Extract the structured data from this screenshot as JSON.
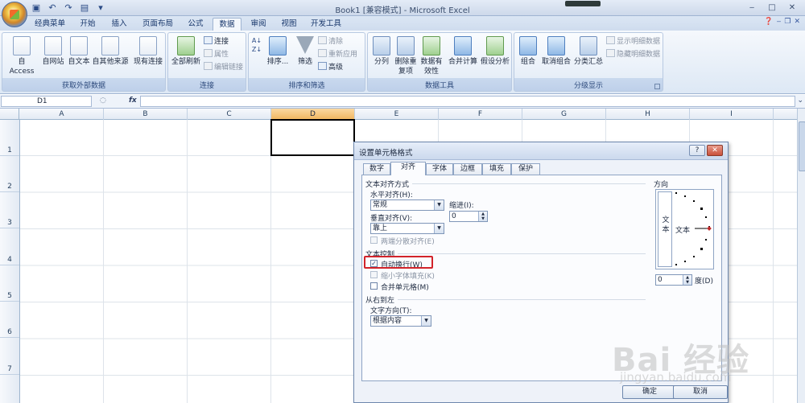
{
  "window": {
    "title": "Book1  [兼容模式] - Microsoft Excel",
    "controls": [
      "‒",
      "□",
      "✕"
    ]
  },
  "ribbon_tabs": [
    "经典菜单",
    "开始",
    "插入",
    "页面布局",
    "公式",
    "数据",
    "审阅",
    "视图",
    "开发工具"
  ],
  "active_tab": "数据",
  "groups": {
    "external": {
      "label": "获取外部数据",
      "buttons": [
        "自 Access",
        "自网站",
        "自文本",
        "自其他来源",
        "现有连接"
      ]
    },
    "connections": {
      "label": "连接",
      "refresh_all": "全部刷新",
      "items": [
        "连接",
        "属性",
        "编辑链接"
      ]
    },
    "sort_filter": {
      "label": "排序和筛选",
      "sort": "排序...",
      "filter": "筛选",
      "items": [
        "清除",
        "重新应用",
        "高级"
      ]
    },
    "data_tools": {
      "label": "数据工具",
      "buttons": [
        "分列",
        "删除重复项",
        "数据有效性",
        "合并计算",
        "假设分析"
      ]
    },
    "outline": {
      "label": "分级显示",
      "buttons": [
        "组合",
        "取消组合",
        "分类汇总"
      ],
      "items": [
        "显示明细数据",
        "隐藏明细数据"
      ]
    }
  },
  "formula_bar": {
    "name_box": "D1",
    "fx": "fx",
    "value": ""
  },
  "columns": [
    "A",
    "B",
    "C",
    "D",
    "E",
    "F",
    "G",
    "H",
    "I"
  ],
  "selected_column": "D",
  "rows": [
    "1",
    "2",
    "3",
    "4",
    "5",
    "6",
    "7"
  ],
  "dialog": {
    "title": "设置单元格格式",
    "title_buttons": [
      "?",
      "✕"
    ],
    "tabs": [
      "数字",
      "对齐",
      "字体",
      "边框",
      "填充",
      "保护"
    ],
    "active_tab": "对齐",
    "text_alignment": {
      "header": "文本对齐方式",
      "horizontal_label": "水平对齐(H):",
      "horizontal_value": "常规",
      "indent_label": "缩进(I):",
      "indent_value": "0",
      "vertical_label": "垂直对齐(V):",
      "vertical_value": "靠上",
      "justify_distributed": "两端分散对齐(E)"
    },
    "text_control": {
      "header": "文本控制",
      "wrap_text": "自动换行(W)",
      "wrap_text_checked": true,
      "shrink_to_fit": "缩小字体填充(K)",
      "merge_cells": "合并单元格(M)"
    },
    "rtl": {
      "header": "从右到左",
      "direction_label": "文字方向(T):",
      "direction_value": "根据内容"
    },
    "orientation": {
      "header": "方向",
      "vertical_text": [
        "文",
        "本"
      ],
      "text": "文本",
      "degrees_value": "0",
      "degrees_label": "度(D)"
    },
    "ok": "确定",
    "cancel": "取消"
  },
  "watermark": {
    "main": "Bai 经验",
    "sub": "jingyan.baidu.com"
  }
}
